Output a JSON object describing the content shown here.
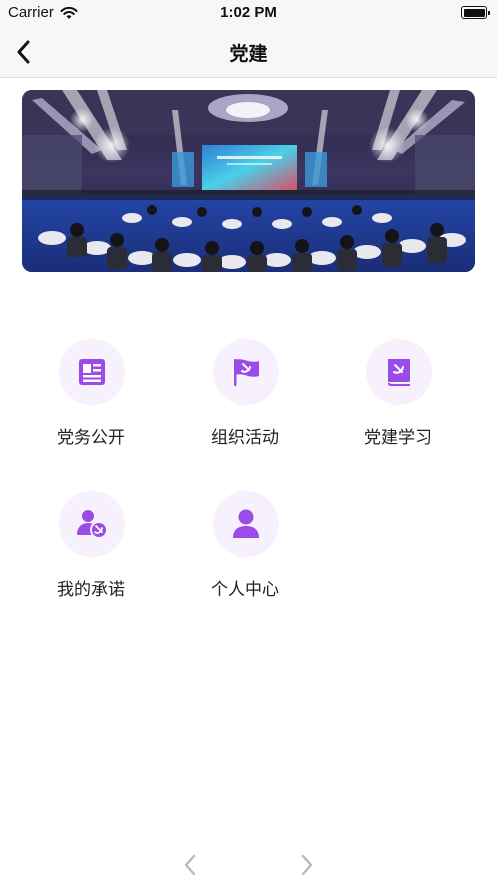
{
  "status_bar": {
    "carrier": "Carrier",
    "time": "1:02 PM"
  },
  "nav": {
    "title": "党建"
  },
  "colors": {
    "accent": "#9b4be8",
    "icon_bg": "#f7f0fd",
    "nav_bg": "#f7f7f7"
  },
  "menu": {
    "items": [
      {
        "label": "党务公开",
        "icon": "newspaper-icon"
      },
      {
        "label": "组织活动",
        "icon": "party-flag-icon"
      },
      {
        "label": "党建学习",
        "icon": "party-book-icon"
      },
      {
        "label": "我的承诺",
        "icon": "user-pledge-icon"
      },
      {
        "label": "个人中心",
        "icon": "person-icon"
      }
    ]
  }
}
